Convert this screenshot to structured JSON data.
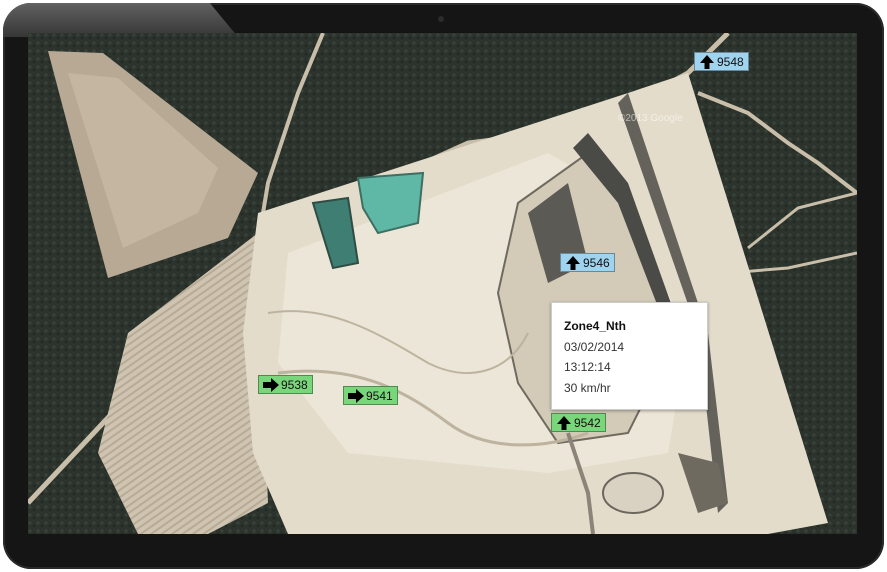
{
  "map": {
    "type": "satellite",
    "watermark": "©2013 Google"
  },
  "markers": [
    {
      "id": "9548",
      "direction": "up",
      "status": "blue"
    },
    {
      "id": "9546",
      "direction": "up",
      "status": "blue"
    },
    {
      "id": "9538",
      "direction": "right",
      "status": "green"
    },
    {
      "id": "9541",
      "direction": "right",
      "status": "green"
    },
    {
      "id": "9542",
      "direction": "up",
      "status": "green"
    }
  ],
  "popup": {
    "zone": "Zone4_Nth",
    "date": "03/02/2014",
    "time": "13:12:14",
    "speed": "30 km/hr"
  },
  "colors": {
    "marker_green": "#7ad67a",
    "marker_blue": "#9fd3ee",
    "forest": "#2a312b",
    "mine_sand": "#e3dccb",
    "pond": "#5fb7a6"
  }
}
